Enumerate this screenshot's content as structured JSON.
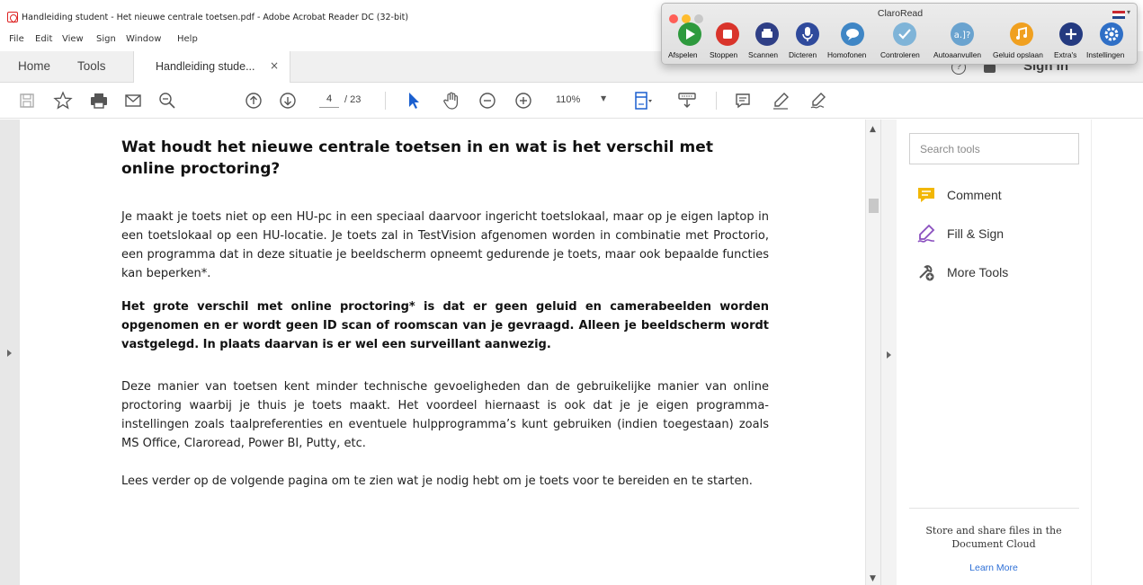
{
  "window": {
    "title": "Handleiding student - Het nieuwe centrale toetsen.pdf - Adobe Acrobat Reader DC (32-bit)"
  },
  "menu": [
    "File",
    "Edit",
    "View",
    "Sign",
    "Window",
    "Help"
  ],
  "tabs": {
    "home": "Home",
    "tools": "Tools",
    "document": "Handleiding stude...",
    "close": "×",
    "help": "?",
    "signin": "Sign In"
  },
  "toolbar": {
    "page_current": "4",
    "page_total": "/ 23",
    "zoom": "110%",
    "icons": [
      "save-icon",
      "bookmark-star-icon",
      "print-icon",
      "email-icon",
      "search-zoom-icon",
      "page-up-icon",
      "page-down-icon",
      "select-arrow-icon",
      "hand-icon",
      "zoom-out-icon",
      "zoom-in-icon",
      "fit-page-icon",
      "read-mode-icon",
      "comment-icon",
      "highlight-pen-icon",
      "sign-icon"
    ]
  },
  "document": {
    "heading": "Wat houdt het nieuwe centrale toetsen in en wat is het verschil met online proctoring?",
    "paragraphs": [
      "Je maakt je toets niet op een HU-pc in een speciaal daarvoor ingericht toetslokaal, maar op je eigen laptop in een toetslokaal op een HU-locatie. Je toets zal in TestVision afgenomen worden in combinatie met Proctorio, een programma dat in deze situatie je beeldscherm opneemt gedurende je toets, maar ook bepaalde functies kan beperken*.",
      "Het grote verschil met online proctoring* is dat er geen geluid en camerabeelden worden opgenomen en  er wordt geen ID scan of roomscan van je gevraagd. Alleen je beeldscherm wordt vastgelegd. In plaats daarvan is er wel een surveillant aanwezig.",
      "Deze manier van toetsen kent minder technische gevoeligheden dan de gebruikelijke manier van online proctoring waarbij je thuis je toets maakt. Het voordeel hiernaast is ook dat je je eigen programma-instellingen zoals taalpreferenties en eventuele hulpprogramma’s kunt gebruiken (indien toegestaan) zoals MS Office, Claroread, Power BI, Putty, etc.",
      "Lees verder op de volgende pagina om te zien wat je nodig hebt om je toets voor te bereiden en te starten."
    ]
  },
  "tools_pane": {
    "search_placeholder": "Search tools",
    "items": [
      "Comment",
      "Fill & Sign",
      "More Tools"
    ],
    "cloud_text_line1": "Store and share files in the",
    "cloud_text_line2": "Document Cloud",
    "cloud_link": "Learn More"
  },
  "claroread": {
    "title": "ClaroRead",
    "buttons": [
      "Afspelen",
      "Stoppen",
      "Scannen",
      "Dicteren",
      "Homofonen",
      "Controleren",
      "Autoaanvullen",
      "Geluid opslaan",
      "Extra's",
      "Instellingen"
    ],
    "colors": [
      "#2e9a3e",
      "#d9342b",
      "#2f3f86",
      "#2f4a9c",
      "#3f86c5",
      "#7fb4d8",
      "#6aa3cf",
      "#f0a020",
      "#243a80",
      "#2f6fc6"
    ]
  }
}
